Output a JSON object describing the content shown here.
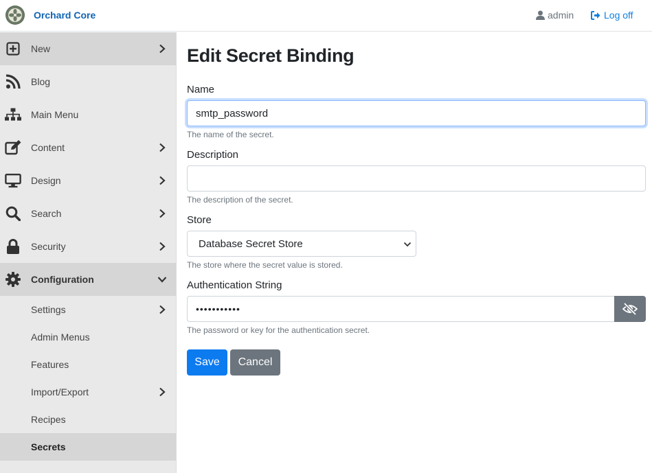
{
  "brand": {
    "name": "Orchard Core",
    "icon": "orchard-logo-icon"
  },
  "header": {
    "user": "admin",
    "logoff": "Log off"
  },
  "sidebar": {
    "items": [
      {
        "label": "New",
        "icon": "plus-square-icon",
        "chevron": true
      },
      {
        "label": "Blog",
        "icon": "rss-icon",
        "chevron": false
      },
      {
        "label": "Main Menu",
        "icon": "sitemap-icon",
        "chevron": false
      },
      {
        "label": "Content",
        "icon": "edit-icon",
        "chevron": true
      },
      {
        "label": "Design",
        "icon": "desktop-icon",
        "chevron": true
      },
      {
        "label": "Search",
        "icon": "search-icon",
        "chevron": true
      },
      {
        "label": "Security",
        "icon": "lock-icon",
        "chevron": true
      },
      {
        "label": "Configuration",
        "icon": "cog-icon",
        "chevron": "down"
      }
    ],
    "sub_items": [
      {
        "label": "Settings",
        "chevron": true
      },
      {
        "label": "Admin Menus",
        "chevron": false
      },
      {
        "label": "Features",
        "chevron": false
      },
      {
        "label": "Import/Export",
        "chevron": true
      },
      {
        "label": "Recipes",
        "chevron": false
      },
      {
        "label": "Secrets",
        "chevron": false,
        "active": true
      }
    ]
  },
  "page": {
    "title": "Edit Secret Binding",
    "name": {
      "label": "Name",
      "value": "smtp_password",
      "hint": "The name of the secret."
    },
    "description": {
      "label": "Description",
      "value": "",
      "hint": "The description of the secret."
    },
    "store": {
      "label": "Store",
      "value": "Database Secret Store",
      "hint": "The store where the secret value is stored."
    },
    "auth": {
      "label": "Authentication String",
      "value": "•••••••••••",
      "hint": "The password or key for the authentication secret.",
      "toggle_icon": "eye-slash-icon"
    },
    "save": "Save",
    "cancel": "Cancel"
  },
  "colors": {
    "brand": "#0f64b4",
    "primary": "#0d7bf0",
    "secondary": "#6c757d",
    "sidebar_bg": "#e9e9e9"
  }
}
